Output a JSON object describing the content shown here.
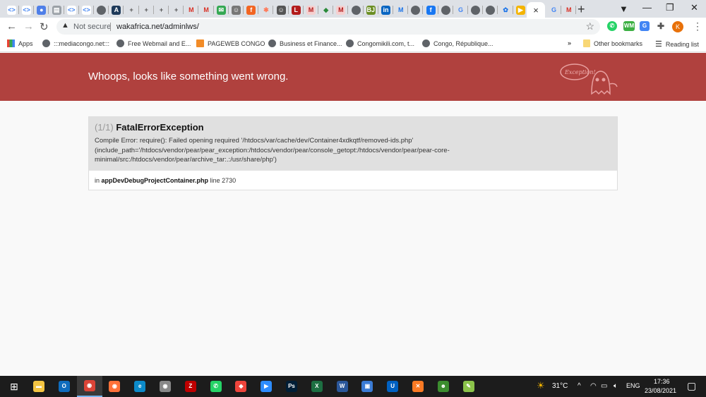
{
  "tabs": [
    {
      "icon": "code-icon",
      "color": "#fff",
      "glyph": "<>",
      "fg": "#4285f4"
    },
    {
      "icon": "code-icon",
      "color": "#fff",
      "glyph": "<>",
      "fg": "#4285f4"
    },
    {
      "icon": "shield-icon",
      "color": "#4f7fe8",
      "glyph": "●"
    },
    {
      "icon": "store-icon",
      "color": "#9aa0a6",
      "glyph": "▤"
    },
    {
      "icon": "code-icon",
      "color": "#fff",
      "glyph": "<>",
      "fg": "#4285f4"
    },
    {
      "icon": "code-icon",
      "color": "#fff",
      "glyph": "<>",
      "fg": "#4285f4"
    },
    {
      "icon": "globe-icon",
      "color": "#5f6368",
      "glyph": ""
    },
    {
      "icon": "triangle-icon",
      "color": "#1e3a5a",
      "glyph": "A"
    },
    {
      "icon": "cross-icon",
      "color": "transparent",
      "glyph": "+",
      "fg": "#555"
    },
    {
      "icon": "cross-icon",
      "color": "transparent",
      "glyph": "+",
      "fg": "#555"
    },
    {
      "icon": "cross-icon",
      "color": "transparent",
      "glyph": "+",
      "fg": "#555"
    },
    {
      "icon": "cross-icon",
      "color": "transparent",
      "glyph": "+",
      "fg": "#555"
    },
    {
      "icon": "gmail-icon",
      "color": "transparent",
      "glyph": "M",
      "fg": "#d93025"
    },
    {
      "icon": "gmail-icon",
      "color": "transparent",
      "glyph": "M",
      "fg": "#d93025"
    },
    {
      "icon": "mail-icon",
      "color": "#34a853",
      "glyph": "✉"
    },
    {
      "icon": "avatar-icon",
      "color": "#777",
      "glyph": "☺"
    },
    {
      "icon": "flash-icon",
      "color": "#f26522",
      "glyph": "f"
    },
    {
      "icon": "hubspot-icon",
      "color": "transparent",
      "glyph": "✱",
      "fg": "#ff7a59"
    },
    {
      "icon": "avatar-icon",
      "color": "#555",
      "glyph": "☺"
    },
    {
      "icon": "l-icon",
      "color": "#b31b1b",
      "glyph": "L"
    },
    {
      "icon": "m-icon",
      "color": "#f5d0d0",
      "glyph": "M",
      "fg": "#b31b1b"
    },
    {
      "icon": "diamond-icon",
      "color": "transparent",
      "glyph": "◆",
      "fg": "#2a8a3a"
    },
    {
      "icon": "m-icon",
      "color": "#f5d0d0",
      "glyph": "M",
      "fg": "#b31b1b"
    },
    {
      "icon": "globe-icon",
      "color": "#5f6368",
      "glyph": ""
    },
    {
      "icon": "bj-icon",
      "color": "#6b8e23",
      "glyph": "BJ"
    },
    {
      "icon": "linkedin-icon",
      "color": "#0a66c2",
      "glyph": "in"
    },
    {
      "icon": "m-blue-icon",
      "color": "transparent",
      "glyph": "M",
      "fg": "#1a73e8"
    },
    {
      "icon": "globe-icon",
      "color": "#5f6368",
      "glyph": ""
    },
    {
      "icon": "facebook-icon",
      "color": "#1877f2",
      "glyph": "f"
    },
    {
      "icon": "globe-icon",
      "color": "#5f6368",
      "glyph": ""
    },
    {
      "icon": "google-icon",
      "color": "transparent",
      "glyph": "G",
      "fg": "#4285f4"
    },
    {
      "icon": "globe-icon",
      "color": "#5f6368",
      "glyph": ""
    },
    {
      "icon": "globe-icon",
      "color": "#5f6368",
      "glyph": ""
    },
    {
      "icon": "gear-icon",
      "color": "transparent",
      "glyph": "✿",
      "fg": "#1a73e8"
    },
    {
      "icon": "camera-icon",
      "color": "#f4b400",
      "glyph": "▶"
    },
    {
      "icon": "close-icon",
      "color": "transparent",
      "glyph": "×",
      "active": true
    },
    {
      "icon": "google-icon",
      "color": "transparent",
      "glyph": "G",
      "fg": "#4285f4"
    },
    {
      "icon": "gmail-icon",
      "color": "transparent",
      "glyph": "M",
      "fg": "#d93025"
    }
  ],
  "toolbar": {
    "security": "Not secure",
    "url": "wakafrica.net/adminlws/",
    "profile_initial": "K"
  },
  "bookmarks": [
    {
      "label": "Apps",
      "icon": "apps-icon"
    },
    {
      "label": ":::mediacongo.net:::",
      "icon": "globe-icon"
    },
    {
      "label": "Free Webmail and E...",
      "icon": "globe-icon"
    },
    {
      "label": "PAGEWEB CONGO",
      "icon": "pageweb-icon"
    },
    {
      "label": "Business et Finance...",
      "icon": "globe-icon"
    },
    {
      "label": "Congomikili.com, t...",
      "icon": "globe-icon"
    },
    {
      "label": "Congo, République...",
      "icon": "globe-icon"
    }
  ],
  "other_bookmarks": "Other bookmarks",
  "reading_list": "Reading list",
  "error": {
    "header": "Whoops, looks like something went wrong.",
    "badge": "Exception!",
    "count": "(1/1)",
    "type": "FatalErrorException",
    "message": "Compile Error: require(): Failed opening required '/htdocs/var/cache/dev/Container4xdkqtf/removed-ids.php' (include_path='/htdocs/vendor/pear/pear_exception:/htdocs/vendor/pear/console_getopt:/htdocs/vendor/pear/pear-core-minimal/src:/htdocs/vendor/pear/archive_tar:.:/usr/share/php')",
    "in": "in",
    "file": "appDevDebugProjectContainer.php",
    "line": "line 2730"
  },
  "taskbar": {
    "apps": [
      {
        "icon": "file-explorer-icon",
        "color": "#f4c542",
        "glyph": "▬"
      },
      {
        "icon": "outlook-icon",
        "color": "#0f6cbd",
        "glyph": "O"
      },
      {
        "icon": "chrome-icon",
        "color": "#db4437",
        "glyph": "◉",
        "active": true
      },
      {
        "icon": "firefox-icon",
        "color": "#ff7139",
        "glyph": "◉"
      },
      {
        "icon": "edge-icon",
        "color": "#0c8ac9",
        "glyph": "e"
      },
      {
        "icon": "github-icon",
        "color": "#888",
        "glyph": "◉"
      },
      {
        "icon": "filezilla-icon",
        "color": "#bf0000",
        "glyph": "Z"
      },
      {
        "icon": "whatsapp-icon",
        "color": "#25d366",
        "glyph": "✆"
      },
      {
        "icon": "anydesk-icon",
        "color": "#ef443b",
        "glyph": "◆"
      },
      {
        "icon": "zoom-icon",
        "color": "#2d8cff",
        "glyph": "▶"
      },
      {
        "icon": "photoshop-icon",
        "color": "#001e36",
        "glyph": "Ps"
      },
      {
        "icon": "excel-icon",
        "color": "#1d6f42",
        "glyph": "X"
      },
      {
        "icon": "word-icon",
        "color": "#2b579a",
        "glyph": "W"
      },
      {
        "icon": "app-icon",
        "color": "#3a7bd5",
        "glyph": "▣"
      },
      {
        "icon": "uplay-icon",
        "color": "#0061c2",
        "glyph": "U"
      },
      {
        "icon": "xampp-icon",
        "color": "#fb7a24",
        "glyph": "✕"
      },
      {
        "icon": "game-icon",
        "color": "#3c8d2f",
        "glyph": "☻"
      },
      {
        "icon": "notepad-icon",
        "color": "#8bc34a",
        "glyph": "✎"
      }
    ],
    "weather": "31°C",
    "language": "ENG",
    "time": "17:36",
    "date": "23/08/2021"
  }
}
